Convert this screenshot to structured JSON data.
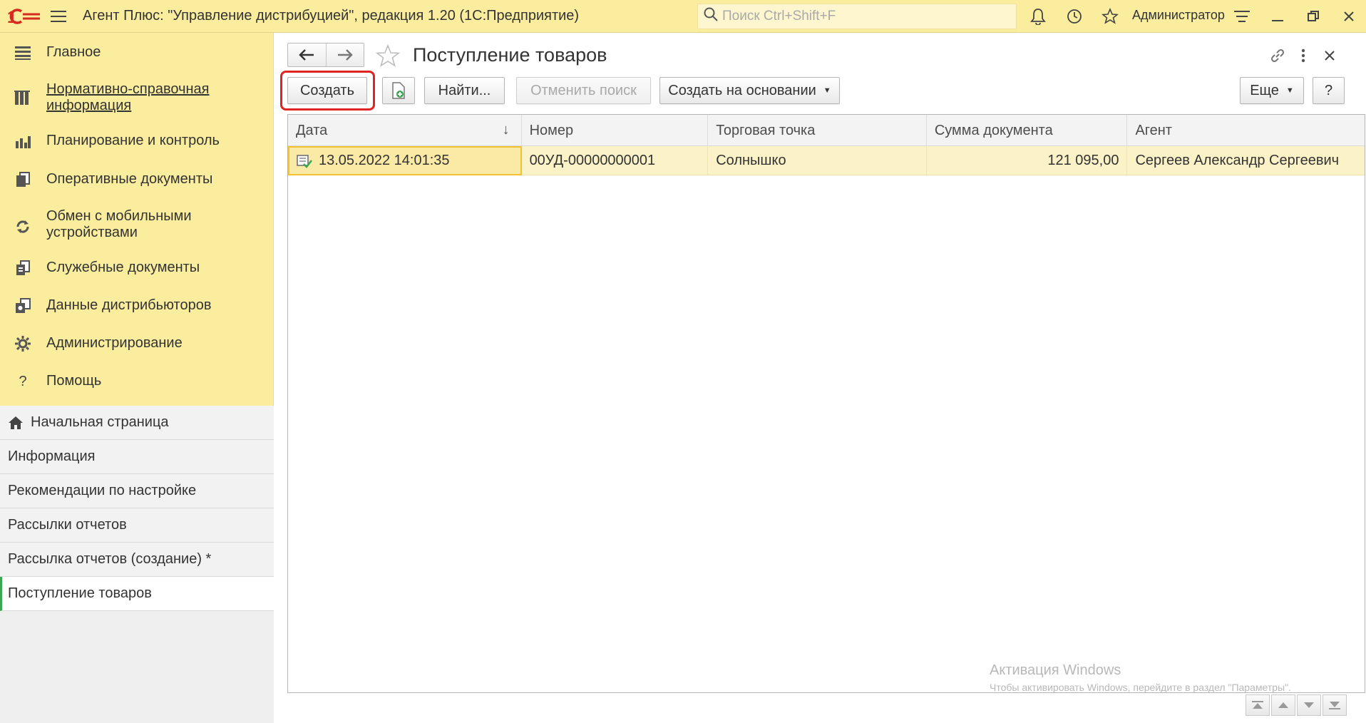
{
  "titlebar": {
    "app_title": "Агент Плюс: \"Управление дистрибуцией\", редакция 1.20  (1С:Предприятие)",
    "search_placeholder": "Поиск Ctrl+Shift+F",
    "user": "Администратор"
  },
  "sidebar": {
    "sections": [
      {
        "label": "Главное",
        "icon": "list-icon"
      },
      {
        "label": "Нормативно-справочная информация",
        "icon": "catalog-icon",
        "link": true
      },
      {
        "label": "Планирование и контроль",
        "icon": "chart-icon"
      },
      {
        "label": "Оперативные документы",
        "icon": "documents-icon"
      },
      {
        "label": "Обмен с мобильными устройствами",
        "icon": "sync-icon"
      },
      {
        "label": "Служебные документы",
        "icon": "service-docs-icon"
      },
      {
        "label": "Данные дистрибьюторов",
        "icon": "distributor-data-icon"
      },
      {
        "label": "Администрирование",
        "icon": "gear-icon"
      },
      {
        "label": "Помощь",
        "icon": "help-icon"
      }
    ],
    "open_windows": [
      {
        "label": "Начальная страница"
      },
      {
        "label": "Информация"
      },
      {
        "label": "Рекомендации по настройке"
      },
      {
        "label": "Рассылки отчетов"
      },
      {
        "label": "Рассылка отчетов (создание) *"
      },
      {
        "label": "Поступление товаров",
        "active": true
      }
    ]
  },
  "form": {
    "title": "Поступление товаров",
    "toolbar": {
      "create": "Создать",
      "find": "Найти...",
      "cancel_search": "Отменить поиск",
      "create_based_on": "Создать на основании",
      "more": "Еще",
      "help": "?"
    },
    "table": {
      "columns": [
        "Дата",
        "Номер",
        "Торговая точка",
        "Сумма документа",
        "Агент"
      ],
      "rows": [
        [
          "13.05.2022 14:01:35",
          "00УД-00000000001",
          "Солнышко",
          "121 095,00",
          "Сергеев Александр Сергеевич"
        ]
      ]
    }
  },
  "watermark": {
    "line1": "Активация Windows",
    "line2": "Чтобы активировать Windows, перейдите в раздел \"Параметры\"."
  },
  "colors": {
    "accent_yellow": "#fbed9e",
    "selection": "#fbf2c8",
    "highlight_red": "#e02424",
    "active_marker": "#3aa552"
  }
}
